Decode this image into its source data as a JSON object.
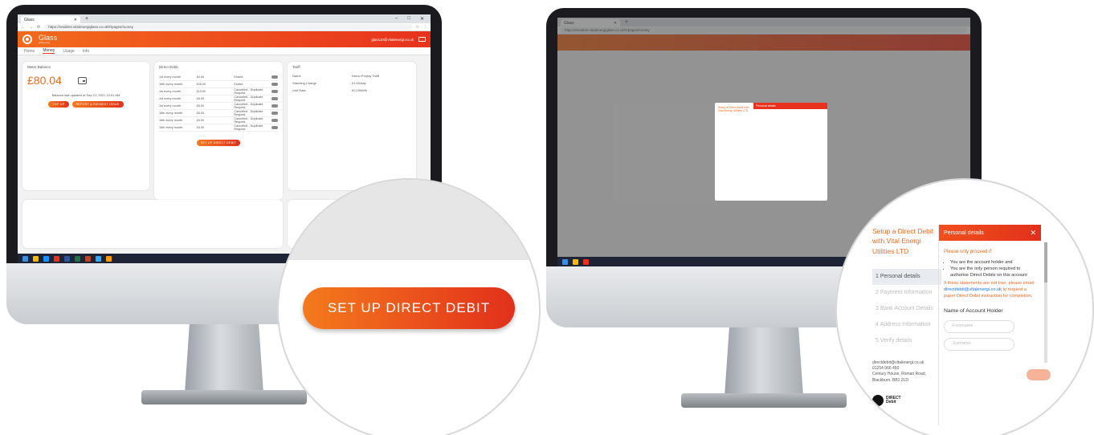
{
  "browser": {
    "tab_title": "Glass",
    "url": "https://resident.vitalenergiglass.co.uk/#/pages/money"
  },
  "app": {
    "brand": "Glass",
    "brand_sub": "vitalenergi",
    "user_email": "glass10@vitalenergi.co.uk",
    "nav": [
      "Home",
      "Money",
      "Usage",
      "Info"
    ]
  },
  "meter_balance": {
    "title": "Meter Balance",
    "amount": "£80.04",
    "updated": "Balance last updated at Sep 21, 2021 10:51 AM",
    "top_up": "TOP UP",
    "report": "REPORT A PAYMENT ISSUE"
  },
  "direct_debit": {
    "title": "Direct Debit",
    "rows": [
      {
        "schedule": "1st every month",
        "amount": "£0.00",
        "status": "Ended"
      },
      {
        "schedule": "16th every month",
        "amount": "£25.00",
        "status": "Ended"
      },
      {
        "schedule": "1st every month",
        "amount": "£10.00",
        "status": "Cancelled - Duplicate Request"
      },
      {
        "schedule": "1st every month",
        "amount": "£5.00",
        "status": "Cancelled - Duplicate Request"
      },
      {
        "schedule": "1st every month",
        "amount": "£5.00",
        "status": "Cancelled - Duplicate Request"
      },
      {
        "schedule": "16th every month",
        "amount": "£5.00",
        "status": "Cancelled - Duplicate Request"
      },
      {
        "schedule": "16th every month",
        "amount": "£5.00",
        "status": "Cancelled - Duplicate Request"
      },
      {
        "schedule": "16th every month",
        "amount": "£5.00",
        "status": "Cancelled - Duplicate Request"
      }
    ],
    "setup_button": "SET UP DIRECT DEBIT"
  },
  "tariff": {
    "title": "Tariff",
    "rows": [
      {
        "label": "Name",
        "value": "Demo Prepay Tariff"
      },
      {
        "label": "Standing Charge",
        "value": "£1.00/day"
      },
      {
        "label": "Unit Rate",
        "value": "£0.19/kWh"
      }
    ]
  },
  "zoom_button": "SET UP DIRECT DEBIT",
  "dd_modal": {
    "side_title": "Setup a Direct Debit with Vital Energi Utilities LTD",
    "steps": [
      "1  Personal details",
      "2  Payment Information",
      "3  Bank Account Details",
      "4  Address Information",
      "5  Verify details"
    ],
    "contact": [
      "directdebit@vitalenergi.co.uk",
      "01254 966 450",
      "Century House, Roman Road,",
      "Blackburn, BB1 2LD"
    ],
    "logo_text": [
      "DIRECT",
      "Debit"
    ],
    "header": "Personal details",
    "warning": "Please only proceed if:",
    "bullets": [
      "You are the account holder and",
      "You are the only person required to authorise Direct Debits on this account"
    ],
    "note_a": "If these statements are not true, please email ",
    "note_email": "directdebit@vitalenergi.co.uk",
    "note_b": " to request a paper Direct Debit instruction for completion.",
    "field_label": "Name of Account Holder",
    "forename_placeholder": "Forename",
    "surname_placeholder": "Surname"
  },
  "colors": {
    "accent_start": "#f47a1c",
    "accent_end": "#e2301c"
  }
}
